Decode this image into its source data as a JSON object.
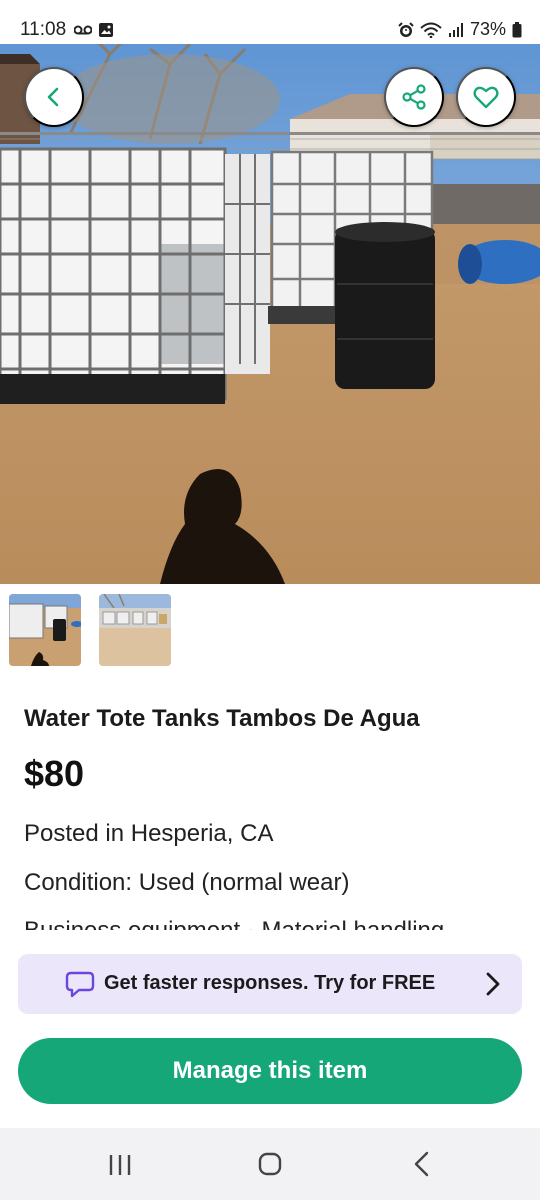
{
  "status_bar": {
    "time": "11:08",
    "battery": "73%",
    "icons": [
      "voicemail-icon",
      "image-icon",
      "alarm-icon",
      "wifi-icon",
      "signal-icon",
      "battery-icon"
    ]
  },
  "hero": {
    "icons": [
      "back-arrow-icon",
      "share-icon",
      "heart-icon"
    ]
  },
  "listing": {
    "title": "Water Tote Tanks Tambos De Agua",
    "price": "$80",
    "posted": "Posted in Hesperia, CA",
    "condition": "Condition: Used (normal wear)",
    "category": "Business equipment · Material handling"
  },
  "promo": {
    "text": "Get faster responses. Try for FREE",
    "icons": [
      "chat-bubble-icon",
      "chevron-right-icon"
    ]
  },
  "actions": {
    "manage": "Manage this item"
  },
  "nav": {
    "icons": [
      "recent-apps-icon",
      "home-icon",
      "back-icon"
    ]
  },
  "colors": {
    "accent": "#15a777",
    "promo_bg": "#ece6fb",
    "promo_icon": "#6b45e0",
    "nav_bg": "#f2f2f4"
  }
}
